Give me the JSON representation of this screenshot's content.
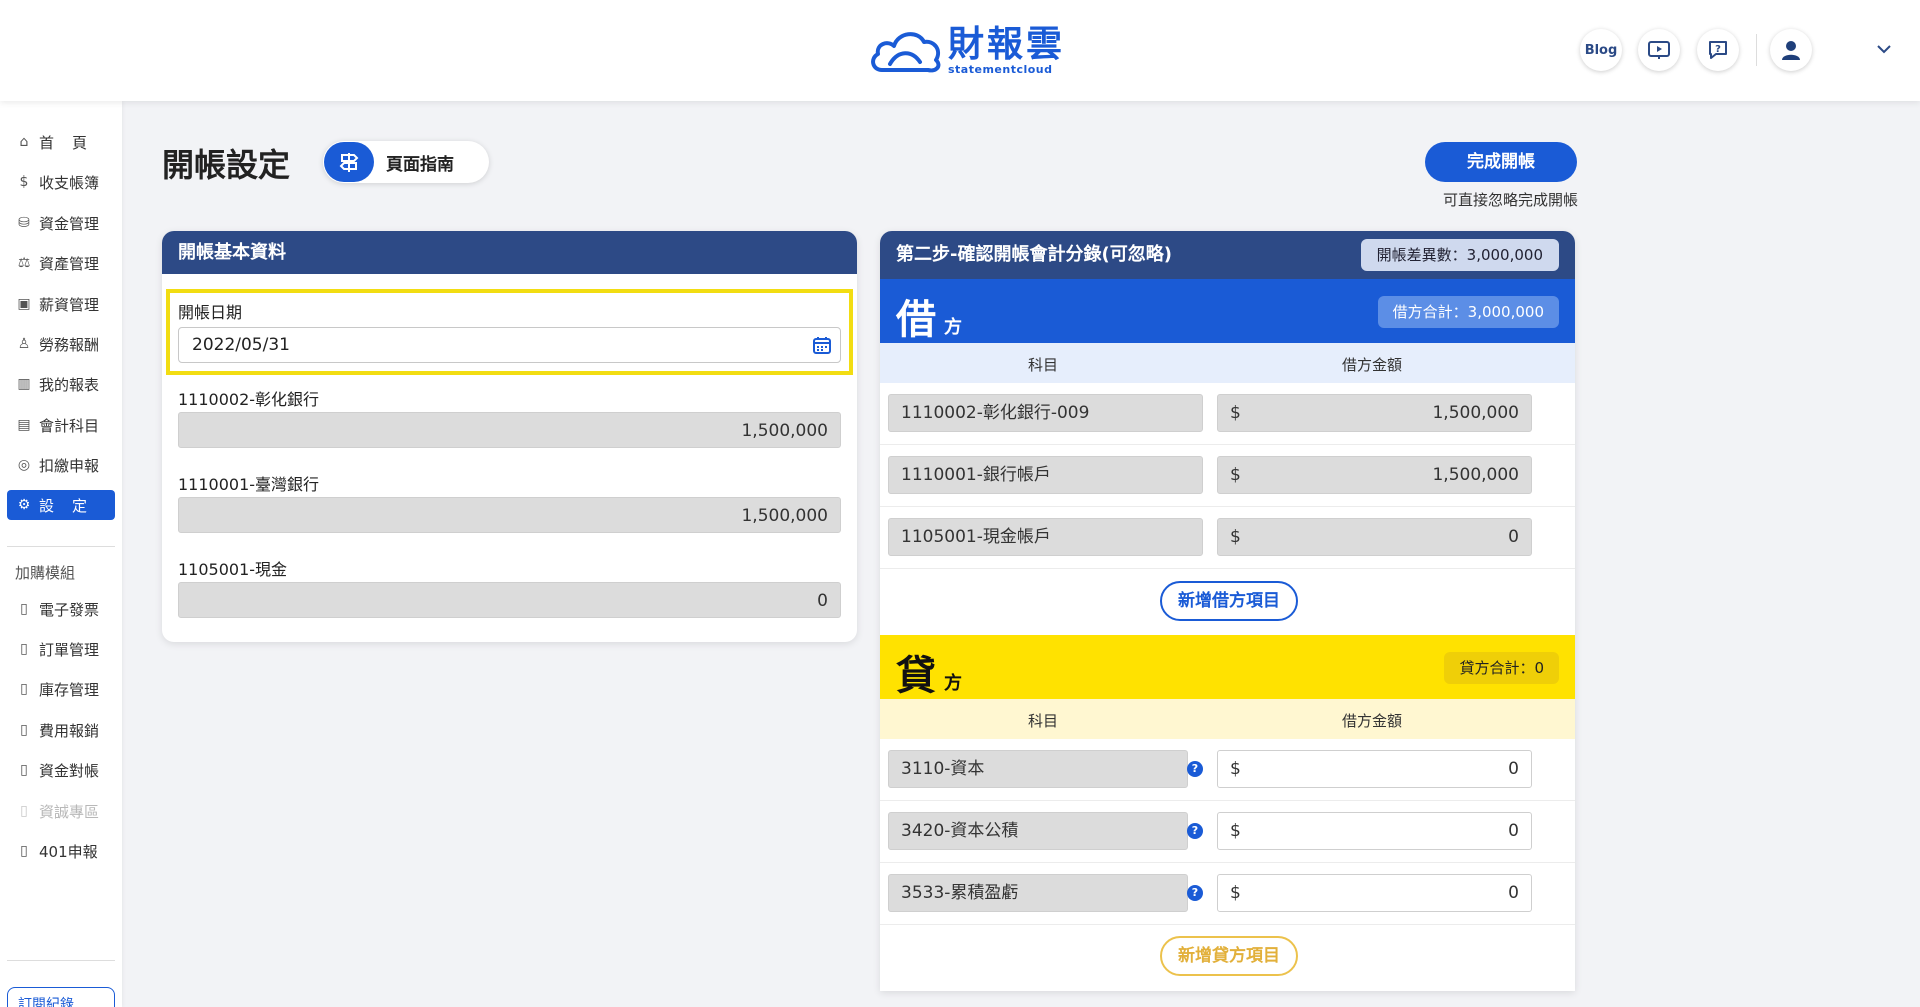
{
  "header": {
    "logo_main": "財報雲",
    "logo_sub": "statementcloud",
    "blog_label": "Blog",
    "icons": [
      "video-guide-icon",
      "help-chat-icon",
      "user-avatar-icon",
      "chevron-down-icon"
    ]
  },
  "sidebar": {
    "items": [
      {
        "label": "首",
        "label2": "頁",
        "icon": "home-icon"
      },
      {
        "label": "收支帳簿",
        "icon": "money-icon"
      },
      {
        "label": "資金管理",
        "icon": "funds-icon"
      },
      {
        "label": "資產管理",
        "icon": "asset-icon"
      },
      {
        "label": "薪資管理",
        "icon": "salary-icon"
      },
      {
        "label": "勞務報酬",
        "icon": "labor-icon"
      },
      {
        "label": "我的報表",
        "icon": "report-icon"
      },
      {
        "label": "會計科目",
        "icon": "ledger-icon"
      },
      {
        "label": "扣繳申報",
        "icon": "tax-icon"
      },
      {
        "label": "設",
        "label2": "定",
        "icon": "settings-icon"
      }
    ],
    "addon_title": "加購模組",
    "addons": [
      "電子發票",
      "訂單管理",
      "庫存管理",
      "費用報銷",
      "資金對帳",
      "資誠專區",
      "401申報"
    ],
    "order_label": "訂閱紀錄"
  },
  "page": {
    "title": "開帳設定",
    "guide_label": "頁面指南",
    "finish_label": "完成開帳",
    "finish_hint": "可直接忽略完成開帳"
  },
  "basic": {
    "title": "開帳基本資料",
    "date_label": "開帳日期",
    "date_value": "2022/05/31",
    "fields": [
      {
        "label": "1110002-彰化銀行",
        "value": "1,500,000"
      },
      {
        "label": "1110001-臺灣銀行",
        "value": "1,500,000"
      },
      {
        "label": "1105001-現金",
        "value": "0"
      }
    ]
  },
  "entries": {
    "title": "第二步-確認開帳會計分錄(可忽略)",
    "diff_label": "開帳差異數：3,000,000",
    "debit": {
      "big": "借",
      "small": "方",
      "total": "借方合計：3,000,000",
      "col_account": "科目",
      "col_amount": "借方金額",
      "currency": "$",
      "rows": [
        {
          "account": "1110002-彰化銀行-009",
          "amount": "1,500,000"
        },
        {
          "account": "1110001-銀行帳戶",
          "amount": "1,500,000"
        },
        {
          "account": "1105001-現金帳戶",
          "amount": "0"
        }
      ],
      "add_label": "新增借方項目"
    },
    "credit": {
      "big": "貸",
      "small": "方",
      "total": "貸方合計：0",
      "col_account": "科目",
      "col_amount": "借方金額",
      "currency": "$",
      "help": "?",
      "rows": [
        {
          "account": "3110-資本",
          "amount": "0"
        },
        {
          "account": "3420-資本公積",
          "amount": "0"
        },
        {
          "account": "3533-累積盈虧",
          "amount": "0"
        }
      ],
      "add_label": "新增貸方項目"
    }
  },
  "colors": {
    "primary": "#1a5bd6",
    "header_navy": "#2d4a86",
    "credit_yellow": "#ffe200",
    "highlight_border": "#f2dd12"
  }
}
